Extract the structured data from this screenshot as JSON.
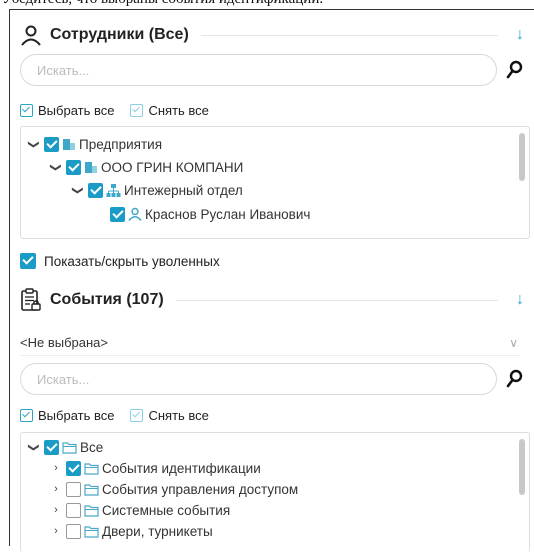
{
  "caption": "Убедитесь, что выбраны события идентификации.",
  "employees": {
    "title": "Сотрудники (Все)",
    "search_placeholder": "Искать...",
    "select_all": "Выбрать все",
    "deselect_all": "Снять все",
    "tree": [
      {
        "label": "Предприятия",
        "checked": true,
        "icon": "building-icon"
      },
      {
        "label": "ООО ГРИН КОМПАНИ",
        "checked": true,
        "icon": "building-icon"
      },
      {
        "label": "Интежерный отдел",
        "checked": true,
        "icon": "org-structure-icon"
      },
      {
        "label": "Краснов Руслан Иванович",
        "checked": true,
        "icon": "person-icon"
      }
    ],
    "show_fired_label": "Показать/скрыть уволенных"
  },
  "events": {
    "title": "События (107)",
    "dropdown_value": "<Не выбрана>",
    "search_placeholder": "Искать...",
    "select_all": "Выбрать все",
    "deselect_all": "Снять все",
    "tree": [
      {
        "label": "Все",
        "checked": true,
        "icon": "folder-icon"
      },
      {
        "label": "События идентификации",
        "checked": true,
        "icon": "folder-icon"
      },
      {
        "label": "События управления доступом",
        "checked": false,
        "icon": "folder-icon"
      },
      {
        "label": "Системные события",
        "checked": false,
        "icon": "folder-icon"
      },
      {
        "label": "Двери, турникеты",
        "checked": false,
        "icon": "folder-icon"
      }
    ]
  },
  "colors": {
    "accent": "#1a9cc6",
    "building": "#3fa8c9",
    "folder": "#4aa7c8"
  }
}
